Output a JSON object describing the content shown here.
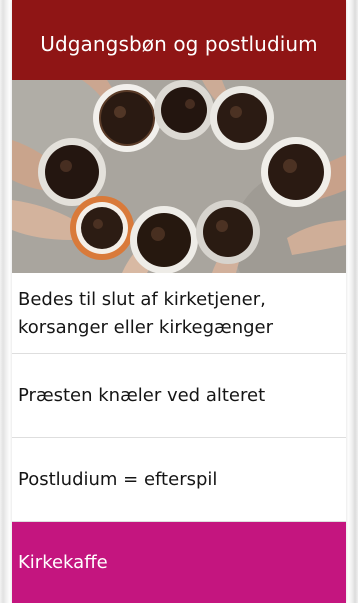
{
  "header": {
    "title": "Udgangsbøn og postludium"
  },
  "image": {
    "subject": "hands holding coffee cups"
  },
  "list": {
    "items": [
      "Bedes til slut af kirketjener, korsanger eller kirkegænger",
      "Præsten knæler ved alteret",
      "Postludium = efterspil",
      "Kirkekaffe"
    ]
  },
  "colors": {
    "header_bg": "#8f1515",
    "active_bg": "#c4157f"
  }
}
